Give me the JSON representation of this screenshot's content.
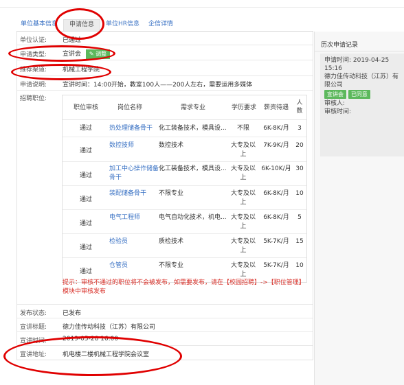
{
  "tabs": [
    "单位基本信息",
    "申请信息",
    "单位HR信息",
    "企信详情"
  ],
  "fields": {
    "cert_label": "单位认证:",
    "cert_value": "已通过",
    "type_label": "申请类型:",
    "type_value": "宣讲会",
    "type_button": "调整",
    "channel_label": "推荐渠道:",
    "channel_value": "机械工程学院",
    "desc_label": "申请说明:",
    "desc_value": "宣讲时间：14:00开始，教室100人——200人左右，需要运用多媒体",
    "positions_label": "招聘职位:",
    "publish_label": "发布状态:",
    "publish_value": "已发布",
    "topic_label": "宣讲标题:",
    "topic_value": "德力佳传动科技（江苏）有限公司",
    "time_label": "宣讲时间:",
    "time_value": "2019-05-28 16:00",
    "place_label": "宣讲地址:",
    "place_value": "机电楼二楼机械工程学院会议室"
  },
  "positions": {
    "headers": [
      "职位审核",
      "岗位名称",
      "需求专业",
      "学历要求",
      "薪资待遇",
      "人数"
    ],
    "rows": [
      {
        "audit": "通过",
        "name": "热处理储备骨干",
        "major": "化工装备技术，模具设...",
        "edu": "不限",
        "salary": "6K-8K/月",
        "num": "3"
      },
      {
        "audit": "通过",
        "name": "数控技师",
        "major": "数控技术",
        "edu": "大专及以上",
        "salary": "7K-9K/月",
        "num": "20"
      },
      {
        "audit": "通过",
        "name": "加工中心操作储备骨干",
        "major": "化工装备技术，模具设...",
        "edu": "大专及以上",
        "salary": "6K-10K/月",
        "num": "30"
      },
      {
        "audit": "通过",
        "name": "装配储备骨干",
        "major": "不限专业",
        "edu": "大专及以上",
        "salary": "6K-8K/月",
        "num": "10"
      },
      {
        "audit": "通过",
        "name": "电气工程师",
        "major": "电气自动化技术，机电...",
        "edu": "大专及以上",
        "salary": "6K-8K/月",
        "num": "5"
      },
      {
        "audit": "通过",
        "name": "检验员",
        "major": "质检技术",
        "edu": "大专及以上",
        "salary": "5K-7K/月",
        "num": "15"
      },
      {
        "audit": "通过",
        "name": "仓管员",
        "major": "不限专业",
        "edu": "大专及以上",
        "salary": "5K-7K/月",
        "num": "10"
      }
    ],
    "tip": "提示：审核不通过的职位将不会被发布，如需要发布，请在【校园招聘】->【职位管理】模块中审核发布"
  },
  "side": {
    "title": "历次申请记录",
    "apply_time_label": "申请时间: 2019-04-25 15:16",
    "company": "德力佳传动科技（江苏）有限公司",
    "badge_type": "宣讲会",
    "badge_status": "已同意",
    "reviewer_label": "审核人:",
    "review_time_label": "审核时间:"
  },
  "colors": {
    "link": "#3a72c4",
    "green": "#5cb85c",
    "tip_red": "#d9322b",
    "annotation_red": "#e00000"
  }
}
